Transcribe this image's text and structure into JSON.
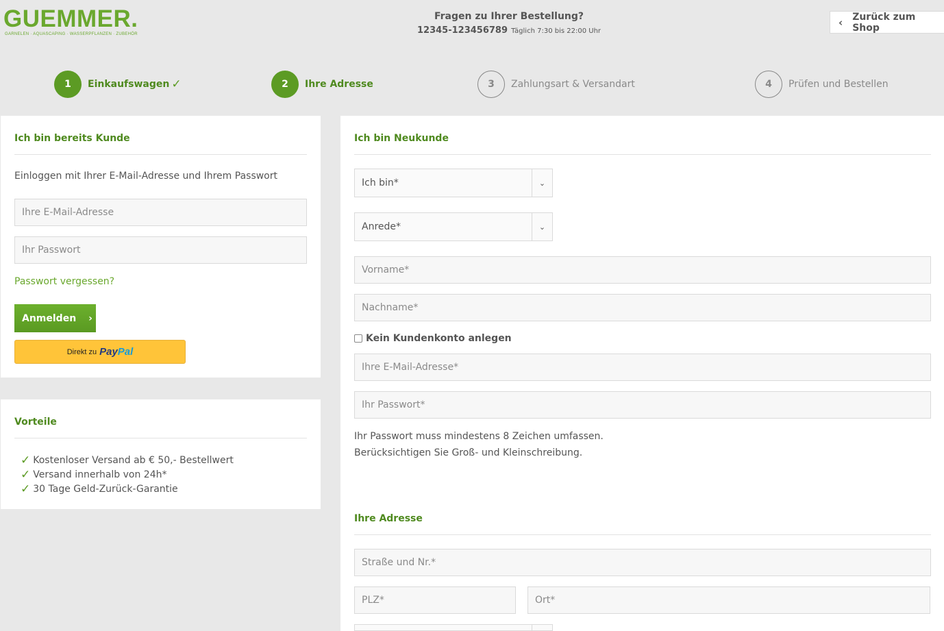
{
  "header": {
    "logo_text": "GUEMMER.",
    "logo_tagline": "GARNELEN · AQUASCAPING · WASSERPFLANZEN · ZUBEHÖR",
    "contact_question": "Fragen zu Ihrer Bestellung?",
    "phone": "12345-123456789",
    "hours": "Täglich 7:30 bis 22:00 Uhr",
    "back_label": "Zurück zum Shop",
    "back_icon": "chevron-left-icon"
  },
  "steps": [
    {
      "number": "1",
      "label": "Einkaufswagen",
      "state": "done"
    },
    {
      "number": "2",
      "label": "Ihre Adresse",
      "state": "active"
    },
    {
      "number": "3",
      "label": "Zahlungsart & Versandart",
      "state": "inactive"
    },
    {
      "number": "4",
      "label": "Prüfen und Bestellen",
      "state": "inactive"
    }
  ],
  "login": {
    "title": "Ich bin bereits Kunde",
    "intro": "Einloggen mit Ihrer E-Mail-Adresse und Ihrem Passwort",
    "email_placeholder": "Ihre E-Mail-Adresse",
    "password_placeholder": "Ihr Passwort",
    "forgot_link": "Passwort vergessen?",
    "login_button": "Anmelden",
    "paypal_prefix": "Direkt zu",
    "paypal_logo_a": "Pay",
    "paypal_logo_b": "Pal"
  },
  "benefits": {
    "title": "Vorteile",
    "items": [
      "Kostenloser Versand ab € 50,- Bestellwert",
      "Versand innerhalb von 24h*",
      "30 Tage Geld-Zurück-Garantie"
    ]
  },
  "register": {
    "title": "Ich bin Neukunde",
    "customer_type_select": "Ich bin*",
    "salutation_select": "Anrede*",
    "firstname_placeholder": "Vorname*",
    "lastname_placeholder": "Nachname*",
    "no_account_label": "Kein Kundenkonto anlegen",
    "no_account_checked": false,
    "email_placeholder": "Ihre E-Mail-Adresse*",
    "password_placeholder": "Ihr Passwort*",
    "password_hint_1": "Ihr Passwort muss mindestens 8 Zeichen umfassen.",
    "password_hint_2": "Berücksichtigen Sie Groß- und Kleinschreibung.",
    "address_title": "Ihre Adresse",
    "street_placeholder": "Straße und Nr.*",
    "zip_placeholder": "PLZ*",
    "city_placeholder": "Ort*"
  },
  "colors": {
    "brand_green": "#5c9b24",
    "paypal_yellow": "#ffc439"
  }
}
